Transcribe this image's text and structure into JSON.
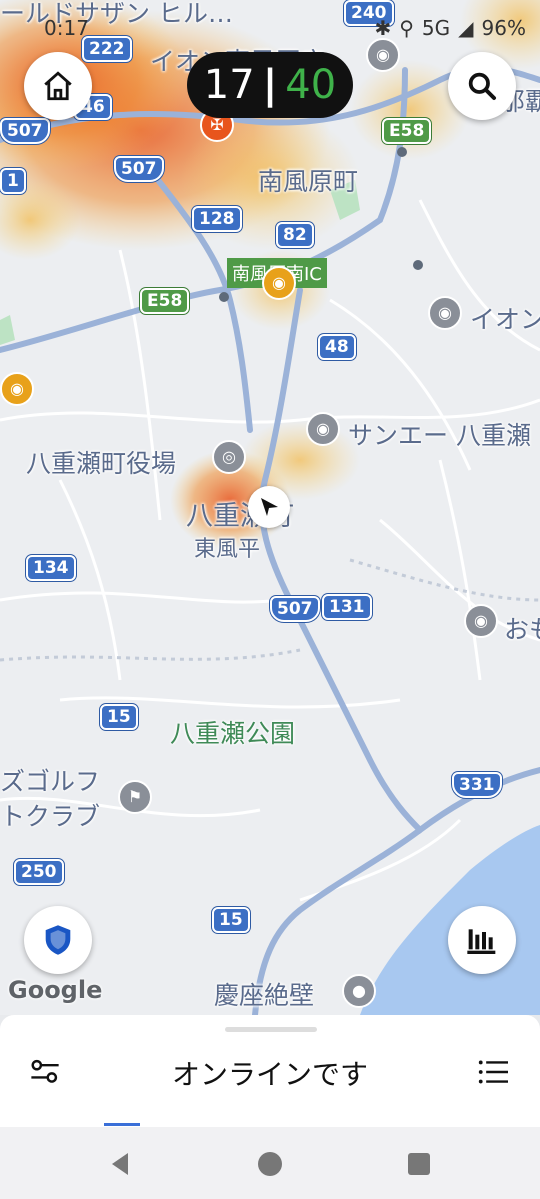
{
  "status_bar": {
    "time": "0:17",
    "network": "5G",
    "battery": "96%"
  },
  "counter": {
    "left_value": "17",
    "separator": "|",
    "right_value": "40",
    "right_color": "#3fb24a"
  },
  "map": {
    "place_labels": {
      "top_banner": "ールドサザン ヒル…",
      "aeon_top": "イオン東風原店",
      "naha": "那覇",
      "haebaru": "南風原町",
      "aeon_right": "イオン",
      "sanei": "サンエー 八重瀬",
      "yaese_office": "八重瀬町役場",
      "yaese_town": "八重瀬町",
      "kochinda": "東風平",
      "omo": "おも",
      "yaese_park": "八重瀬公園",
      "golf1": "ズゴルフ",
      "golf2": "トクラブ",
      "gusan": "慶座絶壁"
    },
    "ic_label": "南風原南IC",
    "route_shields": {
      "r222": "222",
      "r240": "240",
      "r46": "46",
      "r507a": "507",
      "r507b": "507",
      "r128": "128",
      "r82": "82",
      "r48": "48",
      "r134": "134",
      "r507c": "507",
      "r131": "131",
      "r15a": "15",
      "r331": "331",
      "r250": "250",
      "r15b": "15",
      "e58a": "E58",
      "e58b": "E58",
      "r1": "1"
    },
    "attribution": "Google"
  },
  "bottom_sheet": {
    "status_text": "オンラインです"
  },
  "colors": {
    "accent": "#3a6fd8",
    "heat_strong": "#e8551d",
    "heat_weak": "#f3b94a"
  }
}
